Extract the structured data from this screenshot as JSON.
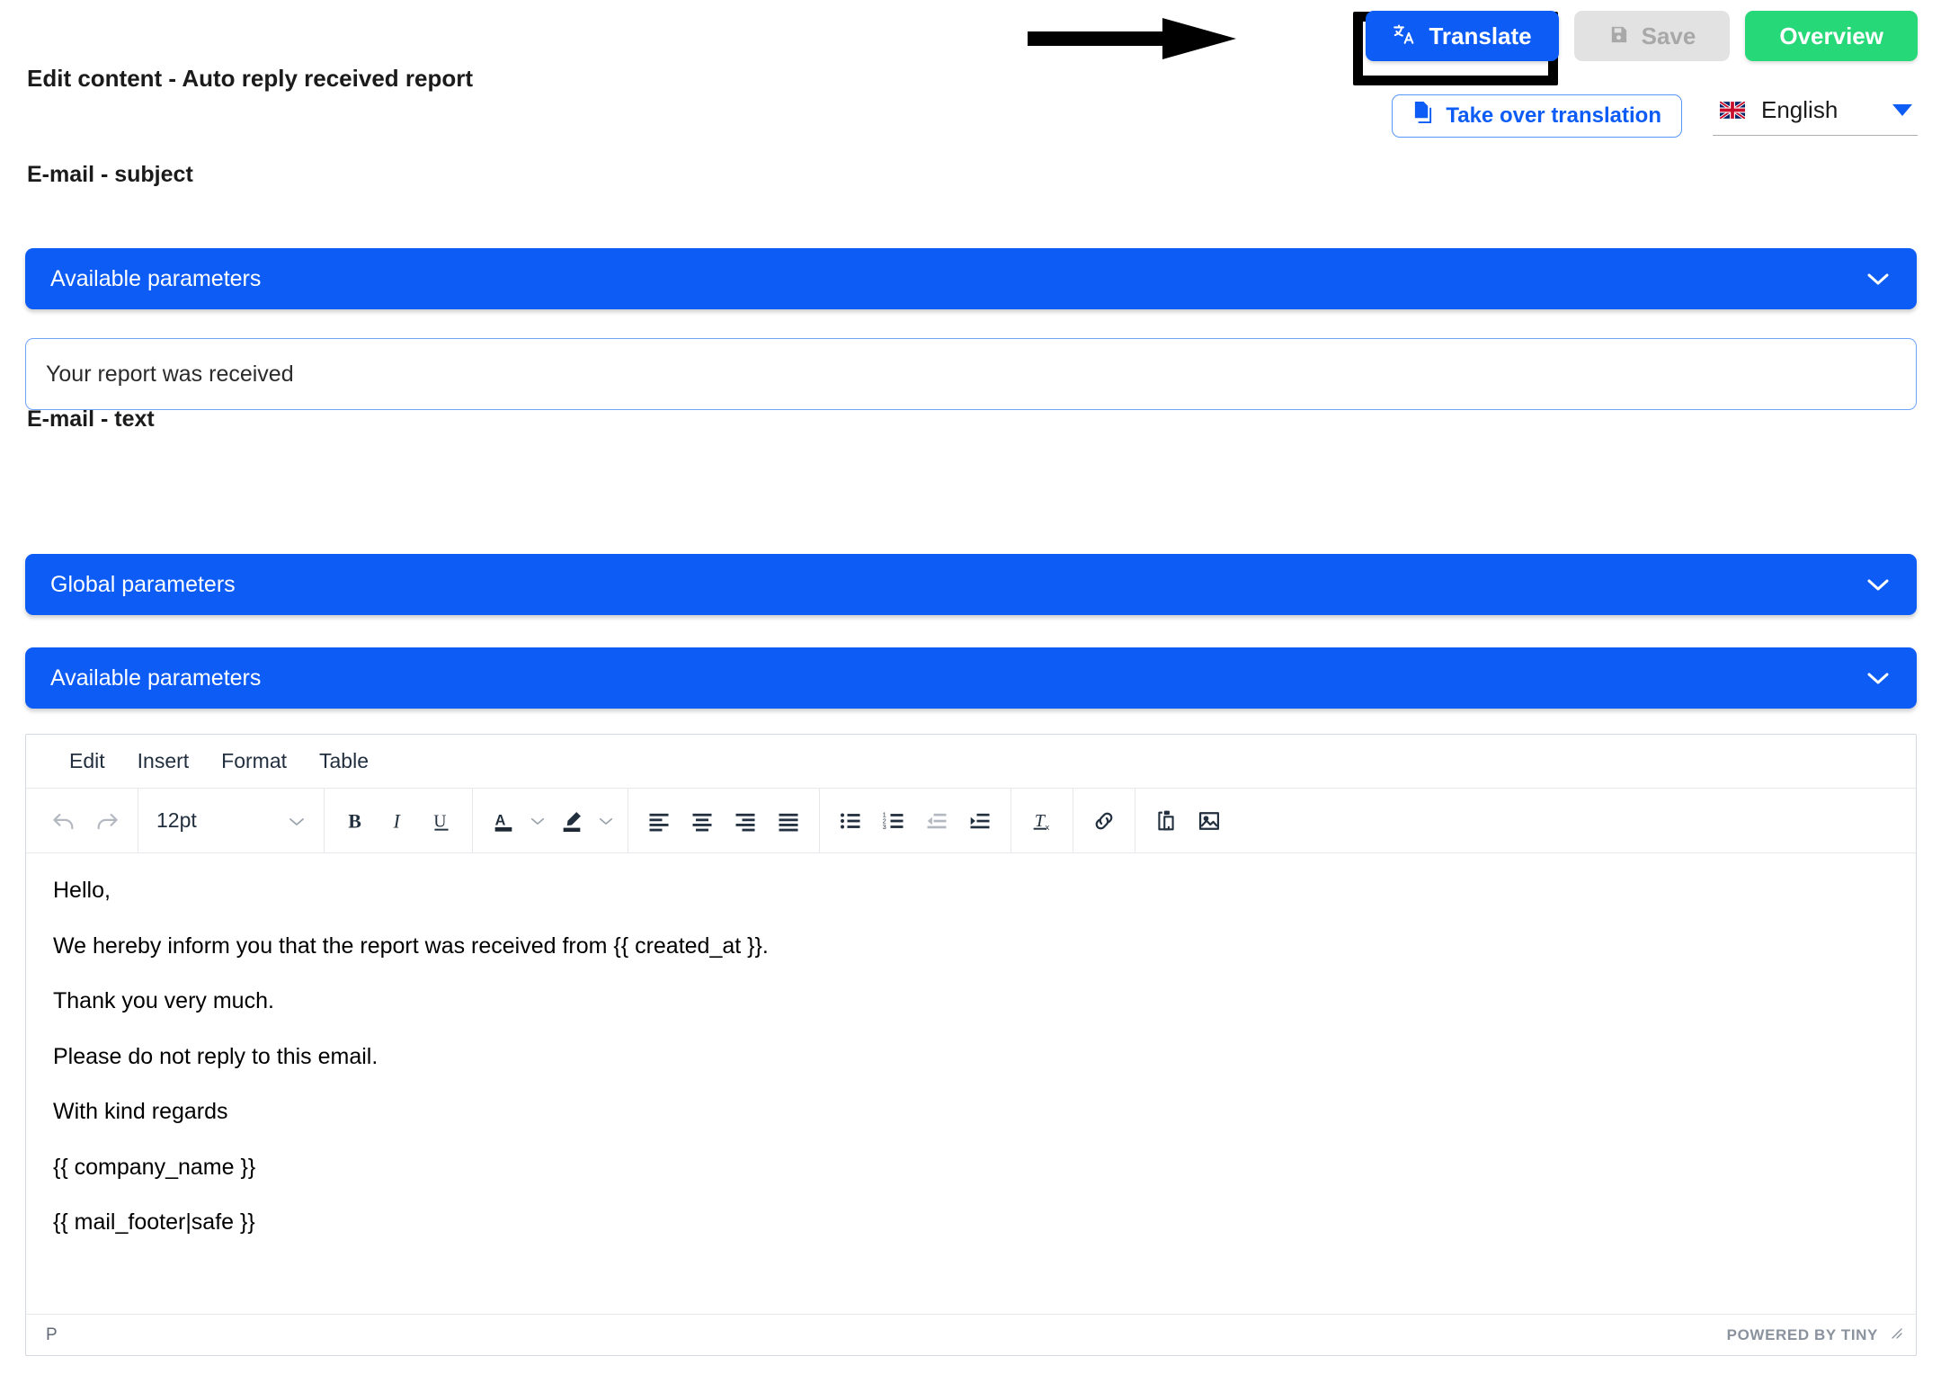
{
  "page_title": "Edit content - Auto reply received report",
  "toolbar_actions": {
    "translate": {
      "label": "Translate",
      "icon": "translate-icon",
      "color": "#0d5cf5"
    },
    "save": {
      "label": "Save",
      "icon": "floppy-disk-icon",
      "disabled": true,
      "color": "#e2e2e2"
    },
    "overview": {
      "label": "Overview",
      "color": "#27d878"
    },
    "take_over_translation": {
      "label": "Take over translation",
      "icon": "copy-document-icon",
      "color": "#0d5cf5"
    },
    "language": {
      "value": "English",
      "flag": "uk-flag-icon",
      "caret": "caret-down-icon"
    }
  },
  "annotation": {
    "type": "arrow-right",
    "target": "translate-button",
    "color": "#000000"
  },
  "sections": [
    {
      "label": "E-mail - subject",
      "accordions": [
        {
          "label": "Available parameters",
          "chevron": "chevron-down-icon"
        }
      ],
      "input_value": "Your report was received"
    },
    {
      "label": "E-mail - text",
      "accordions": [
        {
          "label": "Global parameters",
          "chevron": "chevron-down-icon"
        },
        {
          "label": "Available parameters",
          "chevron": "chevron-down-icon"
        }
      ]
    }
  ],
  "editor": {
    "menubar": [
      "Edit",
      "Insert",
      "Format",
      "Table"
    ],
    "toolbar": {
      "font_size": "12pt",
      "groups": [
        {
          "buttons": [
            {
              "icon": "undo-icon"
            },
            {
              "icon": "redo-icon"
            }
          ]
        },
        {
          "buttons": [
            {
              "icon": "font-size-select"
            }
          ]
        },
        {
          "buttons": [
            {
              "icon": "bold-icon"
            },
            {
              "icon": "italic-icon"
            },
            {
              "icon": "underline-icon"
            }
          ]
        },
        {
          "buttons": [
            {
              "icon": "text-color-icon"
            },
            {
              "icon": "chevron-down-icon"
            },
            {
              "icon": "highlight-color-icon"
            },
            {
              "icon": "chevron-down-icon"
            }
          ]
        },
        {
          "buttons": [
            {
              "icon": "align-left-icon"
            },
            {
              "icon": "align-center-icon"
            },
            {
              "icon": "align-right-icon"
            },
            {
              "icon": "align-justify-icon"
            }
          ]
        },
        {
          "buttons": [
            {
              "icon": "bullet-list-icon"
            },
            {
              "icon": "numbered-list-icon"
            },
            {
              "icon": "outdent-icon"
            },
            {
              "icon": "indent-icon"
            }
          ]
        },
        {
          "buttons": [
            {
              "icon": "clear-formatting-icon"
            }
          ]
        },
        {
          "buttons": [
            {
              "icon": "link-icon"
            }
          ]
        },
        {
          "buttons": [
            {
              "icon": "paste-icon"
            },
            {
              "icon": "image-icon"
            }
          ]
        }
      ]
    },
    "content_paragraphs": [
      "Hello,",
      "We hereby inform you that the report was received from {{ created_at }}.",
      "Thank you very much.",
      "Please do not reply to this email.",
      "With kind regards",
      "{{ company_name }}",
      "{{ mail_footer|safe }}"
    ],
    "statusbar": {
      "element_path": "P",
      "branding": "POWERED BY TINY",
      "resize": "resize-handle-icon"
    }
  }
}
